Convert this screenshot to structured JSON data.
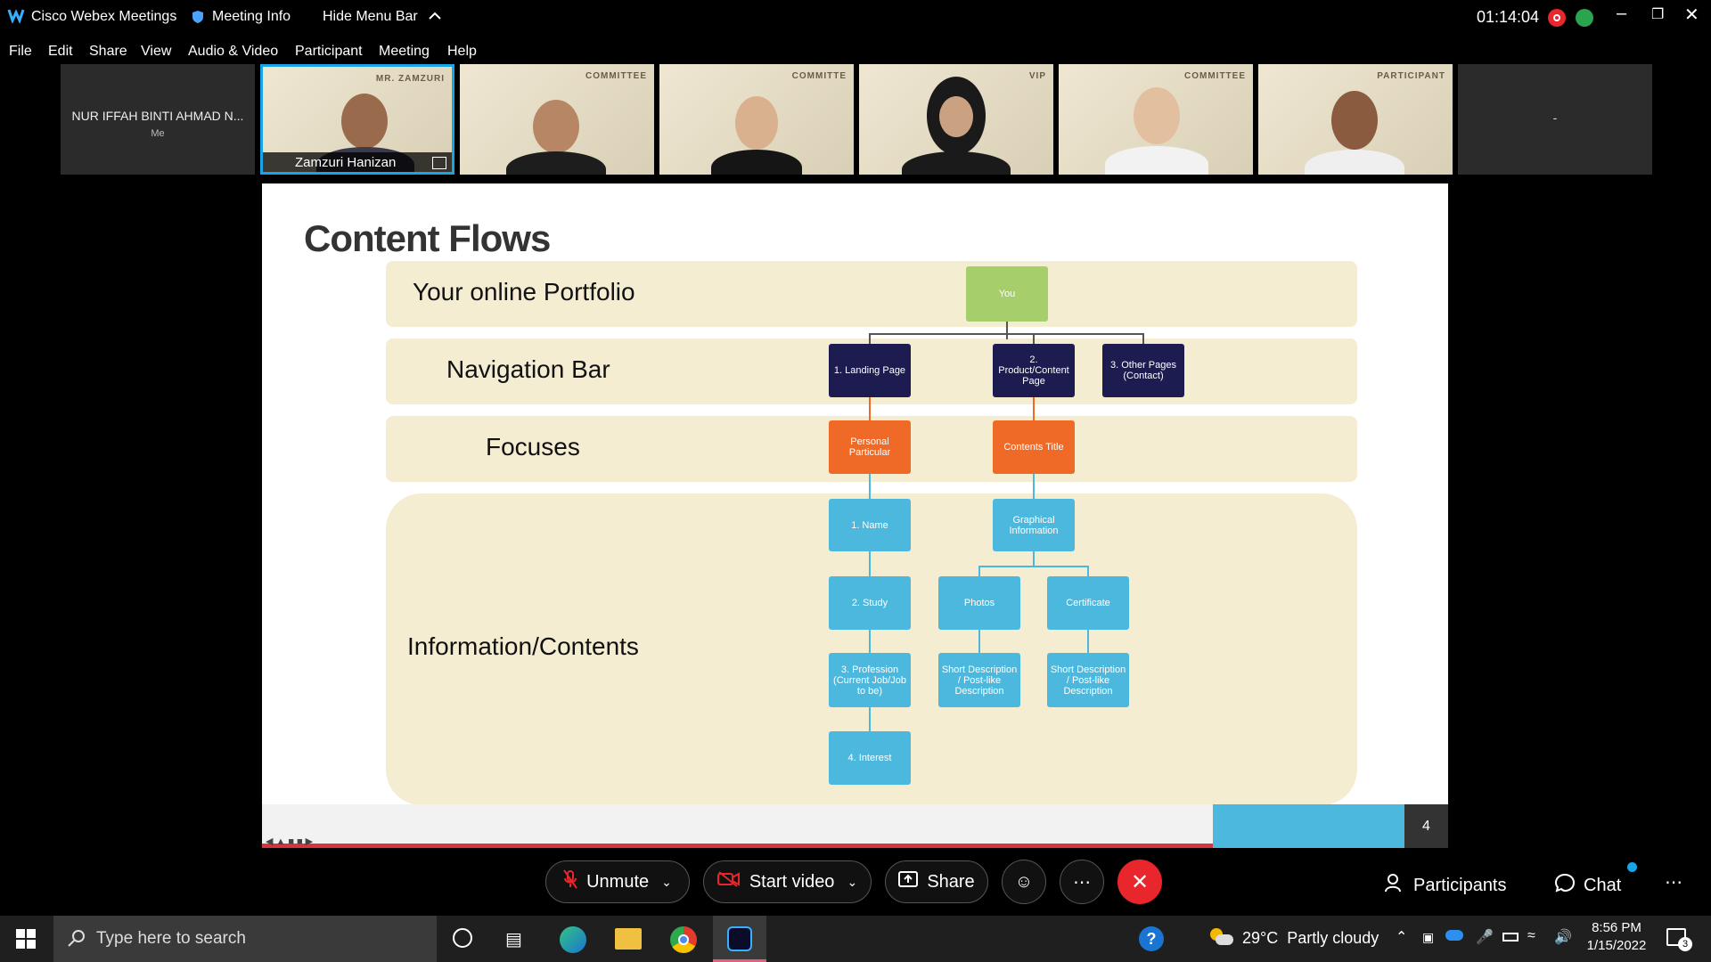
{
  "window": {
    "app_title": "Cisco Webex Meetings",
    "meeting_info": "Meeting Info",
    "hide_menu": "Hide Menu Bar",
    "timer": "01:14:04"
  },
  "menu": [
    "File",
    "Edit",
    "Share",
    "View",
    "Audio & Video",
    "Participant",
    "Meeting",
    "Help"
  ],
  "participants": {
    "self_name": "NUR IFFAH BINTI AHMAD N...",
    "self_sub": "Me",
    "active_speaker": "Zamzuri Hanizan",
    "tags": [
      "MR. ZAMZURI",
      "COMMITTEE",
      "COMMITTE",
      "VIP",
      "COMMITTEE",
      "PARTICIPANT"
    ],
    "last_tile_label": "-"
  },
  "slide": {
    "title": "Content Flows",
    "rows": [
      "Your online Portfolio",
      "Navigation Bar",
      "Focuses",
      "Information/Contents"
    ],
    "boxes": {
      "you": "You",
      "landing": "1. Landing Page",
      "product": "2. Product/Content Page",
      "other": "3. Other Pages (Contact)",
      "personal": "Personal Particular",
      "contents_title": "Contents Title",
      "name": "1. Name",
      "graphical": "Graphical Information",
      "study": "2. Study",
      "photos": "Photos",
      "certificate": "Certificate",
      "profession": "3. Profession (Current Job/Job to be)",
      "desc1": "Short Description / Post-like Description",
      "desc2": "Short Description / Post-like Description",
      "interest": "4. Interest"
    },
    "page_number": "4"
  },
  "controls": {
    "unmute": "Unmute",
    "start_video": "Start video",
    "share": "Share",
    "participants": "Participants",
    "chat": "Chat"
  },
  "taskbar": {
    "search_placeholder": "Type here to search",
    "weather": "29°C  Partly cloudy",
    "time": "8:56 PM",
    "date": "1/15/2022",
    "notifications": "3"
  },
  "colors": {
    "accent_blue": "#1aa4e8",
    "end_red": "#e8262b",
    "box_orange": "#f06a27",
    "box_navy": "#1c1c50",
    "box_blue": "#4db8de",
    "box_green": "#a6cf6b",
    "band": "#f4edd2"
  }
}
